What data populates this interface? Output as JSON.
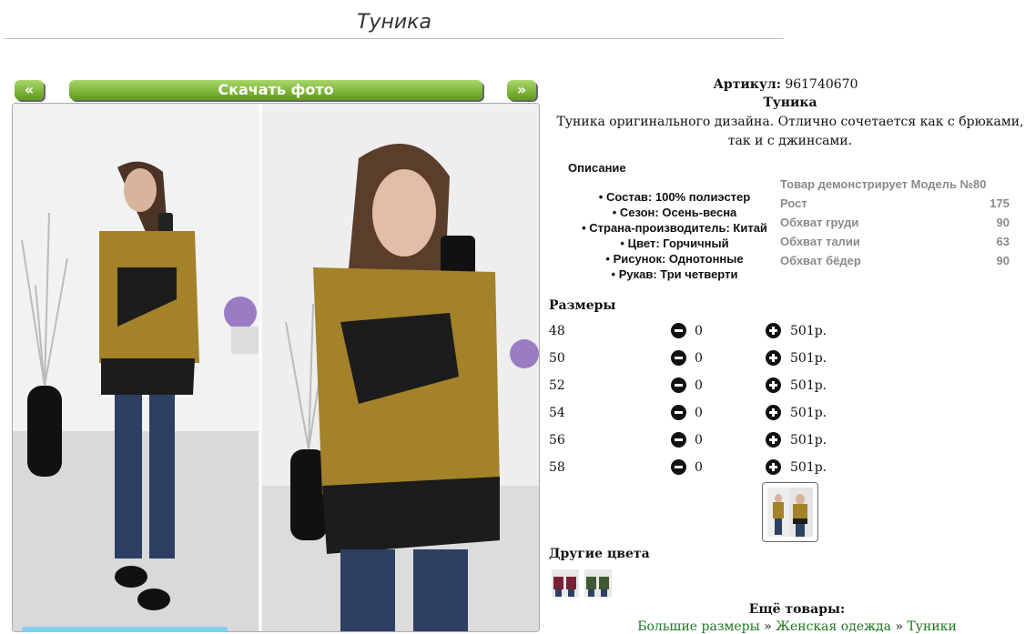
{
  "page": {
    "title": "Туника"
  },
  "gallery": {
    "prev_label": "«",
    "next_label": "»",
    "download_label": "Скачать фото"
  },
  "product": {
    "article_label": "Артикул:",
    "article_value": "961740670",
    "name": "Туника",
    "description": "Туника оригинального дизайна. Отлично сочетается как с брюками, так и с джинсами."
  },
  "details": {
    "heading": "Описание",
    "items": [
      "Состав: 100% полиэстер",
      "Сезон: Осень-весна",
      "Страна-производитель: Китай",
      "Цвет: Горчичный",
      "Рисунок: Однотонные",
      "Рукав: Три четверти"
    ]
  },
  "model": {
    "heading": "Товар демонстрирует Модель №80",
    "rows": [
      {
        "label": "Рост",
        "value": "175"
      },
      {
        "label": "Обхват груди",
        "value": "90"
      },
      {
        "label": "Обхват талии",
        "value": "63"
      },
      {
        "label": "Обхват бёдер",
        "value": "90"
      }
    ]
  },
  "sizes": {
    "heading": "Размеры",
    "rows": [
      {
        "size": "48",
        "qty": "0",
        "price": "501р."
      },
      {
        "size": "50",
        "qty": "0",
        "price": "501р."
      },
      {
        "size": "52",
        "qty": "0",
        "price": "501р."
      },
      {
        "size": "54",
        "qty": "0",
        "price": "501р."
      },
      {
        "size": "56",
        "qty": "0",
        "price": "501р."
      },
      {
        "size": "58",
        "qty": "0",
        "price": "501р."
      }
    ]
  },
  "other_colors": {
    "heading": "Другие цвета"
  },
  "more": {
    "heading": "Ещё товары:",
    "crumbs": [
      "Большие размеры",
      "Женская одежда",
      "Туники"
    ],
    "separator": "»"
  },
  "colors": {
    "accent_green": "#5e9a17",
    "garment_mustard": "#a3822a",
    "garment_black": "#1c1c1c",
    "link_green": "#1a7a1a"
  }
}
